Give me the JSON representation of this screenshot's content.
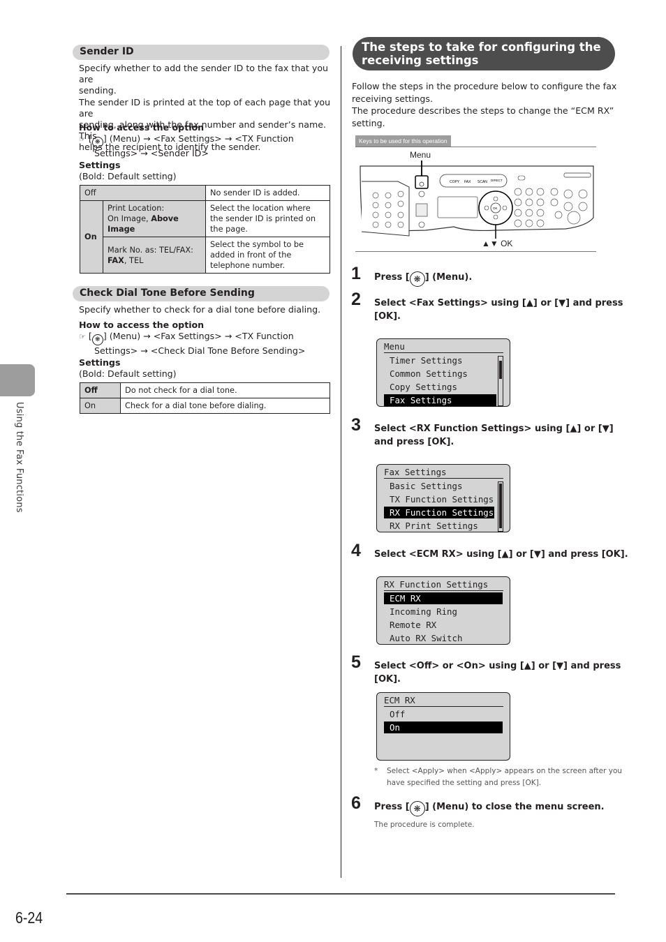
{
  "side_tab": {
    "label": "Using the Fax Functions"
  },
  "page_number": "6-24",
  "left": {
    "sender_id": {
      "heading": "Sender ID",
      "desc_lines": [
        "Specify whether to add the sender ID to the fax that you are",
        "sending.",
        "The sender ID is printed at the top of each page that you are",
        "sending, along with the fax number and sender’s name. This",
        "helps the recipient to identify the sender."
      ],
      "access_heading": "How to access the option",
      "access_line1": "[ ] (Menu) → <Fax Settings> → <TX Function",
      "access_line1_pre": "[",
      "access_line1_post": "] (Menu) → <Fax Settings> → <TX Function",
      "access_line2": "Settings> → <Sender ID>",
      "settings_heading": "Settings",
      "settings_note": "(Bold: Default setting)",
      "table": {
        "off_label": "Off",
        "off_desc": "No sender ID is added.",
        "on_label": "On",
        "rows": [
          {
            "option_line1": "Print Location:",
            "option_plain": "On Image, ",
            "option_bold": "Above Image",
            "desc": "Select the location where the sender ID is printed on the page."
          },
          {
            "option_line1": "Mark No. as: TEL/FAX:",
            "option_bold": "FAX",
            "option_plain": ", TEL",
            "desc": "Select the symbol to be added in front of the telephone number."
          }
        ]
      }
    },
    "dial_tone": {
      "heading": "Check Dial Tone Before Sending",
      "desc": "Specify whether to check for a dial tone before dialing.",
      "access_heading": "How to access the option",
      "access_line1_pre": "[",
      "access_line1_post": "] (Menu) → <Fax Settings> → <TX Function",
      "access_line2": "Settings> → <Check Dial Tone Before Sending>",
      "settings_heading": "Settings",
      "settings_note": "(Bold: Default setting)",
      "table": [
        {
          "option": "Off",
          "desc": "Do not check for a dial tone.",
          "default": true
        },
        {
          "option": "On",
          "desc": "Check for a dial tone before dialing.",
          "default": false
        }
      ]
    }
  },
  "right": {
    "heading_line1": "The steps to take for configuring the",
    "heading_line2": "receiving settings",
    "intro_lines": [
      "Follow the steps in the procedure below to configure the fax",
      "receiving settings.",
      "The procedure describes the steps to change the “ECM RX”",
      "setting."
    ],
    "keys_label": "Keys to be used for this operation",
    "panel_callouts": {
      "menu": "Menu",
      "ok": "▲▼ OK"
    },
    "panel_buttons": [
      "COPY",
      "FAX",
      "SCAN",
      "DIRECT PRINT",
      "OK"
    ],
    "steps": [
      {
        "num": "1",
        "pre": "Press [",
        "post": "] (Menu)."
      },
      {
        "num": "2",
        "line1": "Select <Fax Settings> using [▲] or [▼] and press",
        "line2": "[OK].",
        "lcd": {
          "title": "Menu",
          "items": [
            "Timer Settings",
            "Common Settings",
            "Copy Settings",
            "Fax Settings"
          ],
          "selected": 3
        }
      },
      {
        "num": "3",
        "line1": "Select <RX Function Settings> using [▲] or [▼]",
        "line2": "and press [OK].",
        "lcd": {
          "title": "Fax Settings",
          "items": [
            "Basic Settings",
            "TX Function Settings",
            "RX Function Settings",
            "RX Print Settings"
          ],
          "selected": 2
        }
      },
      {
        "num": "4",
        "line1": "Select <ECM RX> using [▲] or [▼] and press [OK].",
        "lcd": {
          "title": "RX Function Settings",
          "items": [
            "ECM RX",
            "Incoming Ring",
            "Remote RX",
            "Auto RX Switch"
          ],
          "selected": 0
        }
      },
      {
        "num": "5",
        "line1": "Select <Off> or <On> using [▲] or [▼] and press",
        "line2": "[OK].",
        "lcd": {
          "title": "ECM RX",
          "items": [
            "Off",
            "On"
          ],
          "selected": 1
        },
        "note_mark": "*",
        "note_line1": "Select <Apply> when <Apply> appears on the screen after you",
        "note_line2": "have specified the setting and press [OK]."
      },
      {
        "num": "6",
        "pre": "Press [",
        "post": "] (Menu) to close the menu screen.",
        "note": "The procedure is complete."
      }
    ]
  }
}
